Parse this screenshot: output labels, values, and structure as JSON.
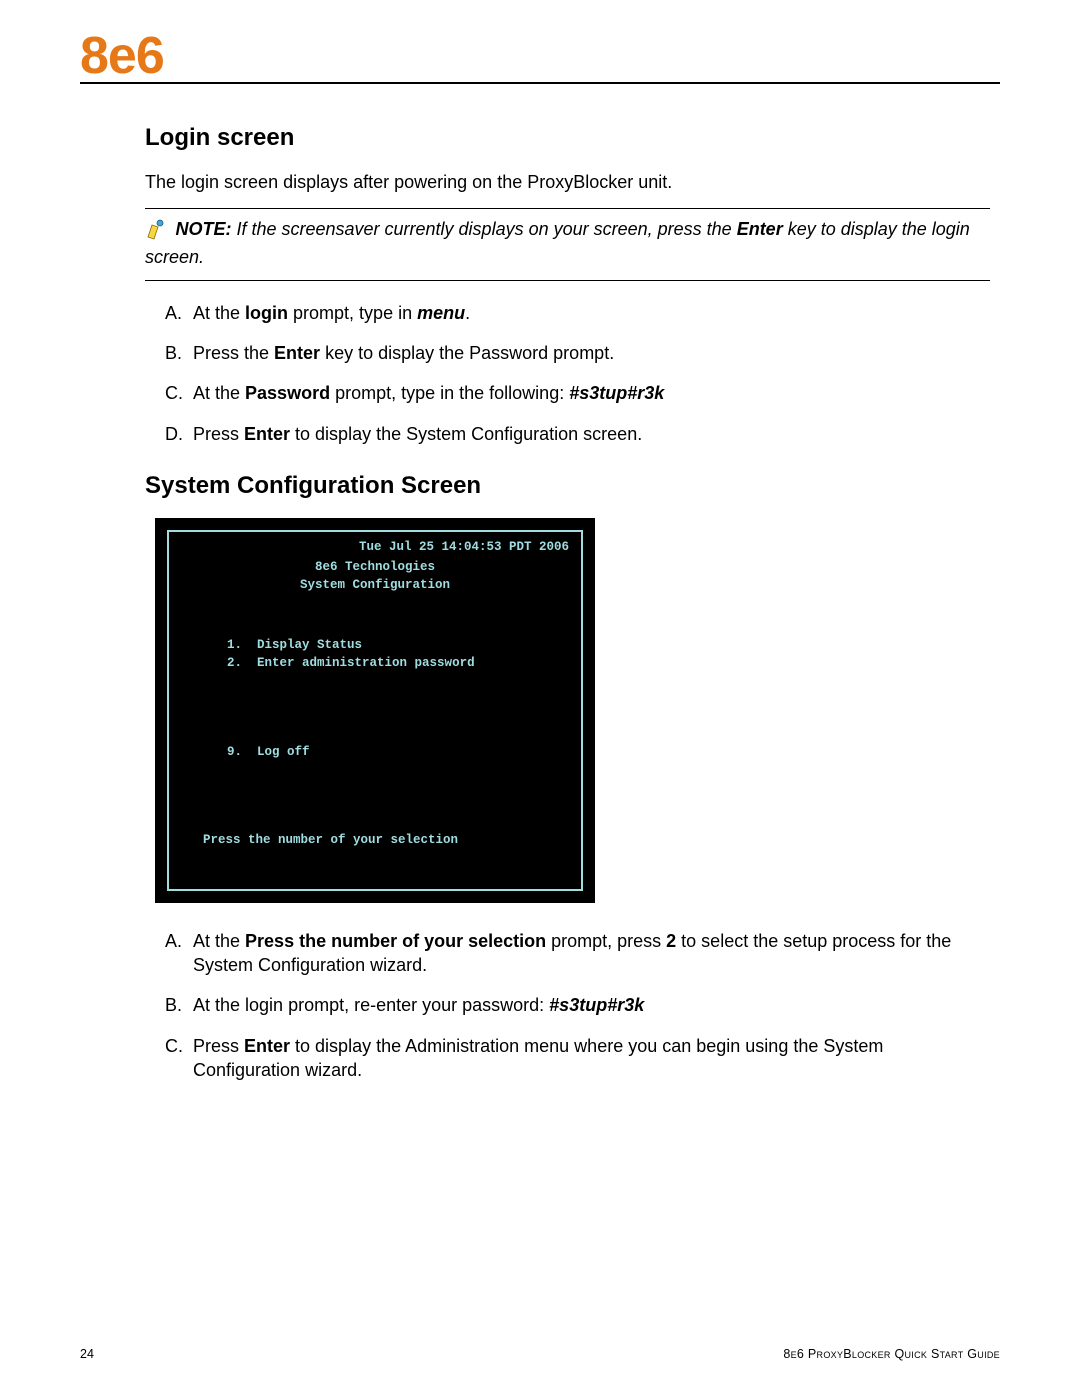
{
  "logo": "8e6",
  "section1": {
    "title": "Login screen",
    "intro": "The login screen displays after powering on the ProxyBlocker unit.",
    "note_prefix": "NOTE:",
    "note_body_1": " If the screensaver currently displays on your screen, press the ",
    "note_bold": "Enter",
    "note_body_2": " key to display the login screen.",
    "steps": [
      {
        "m": "A.",
        "pre": "At the ",
        "b1": "login",
        "mid": " prompt, type in ",
        "b2": "menu",
        "post": "."
      },
      {
        "m": "B.",
        "pre": "Press the ",
        "b1": "Enter",
        "mid": " key to display the Password prompt.",
        "b2": "",
        "post": ""
      },
      {
        "m": "C.",
        "pre": "At the ",
        "b1": "Password",
        "mid": " prompt, type in the following: ",
        "b2": "#s3tup#r3k",
        "post": ""
      },
      {
        "m": "D.",
        "pre": "Press ",
        "b1": "Enter",
        "mid": " to display the System Configuration screen.",
        "b2": "",
        "post": ""
      }
    ]
  },
  "section2": {
    "title": "System Configuration Screen",
    "terminal": {
      "date": "Tue Jul 25 14:04:53 PDT 2006",
      "company": "8e6 Technologies",
      "subtitle": "System Configuration",
      "menu1_num": "1.",
      "menu1_txt": "Display Status",
      "menu2_num": "2.",
      "menu2_txt": "Enter administration password",
      "menu9_num": "9.",
      "menu9_txt": "Log off",
      "prompt": "Press the number of your selection"
    },
    "steps": [
      {
        "m": "A.",
        "pre": "At the ",
        "b1": "Press the number of your selection",
        "mid": " prompt, press ",
        "b2": "2",
        "post": " to select the setup process for the System Configuration wizard."
      },
      {
        "m": "B.",
        "pre": "At the login prompt, re-enter your password: ",
        "b1": "#s3tup#r3k",
        "mid": "",
        "b2": "",
        "post": ""
      },
      {
        "m": "C.",
        "pre": "Press ",
        "b1": "Enter",
        "mid": " to display the Administration menu where you can begin using the System Configuration wizard.",
        "b2": "",
        "post": ""
      }
    ]
  },
  "footer": {
    "page": "24",
    "guide": "8e6 ProxyBlocker Quick Start Guide"
  }
}
